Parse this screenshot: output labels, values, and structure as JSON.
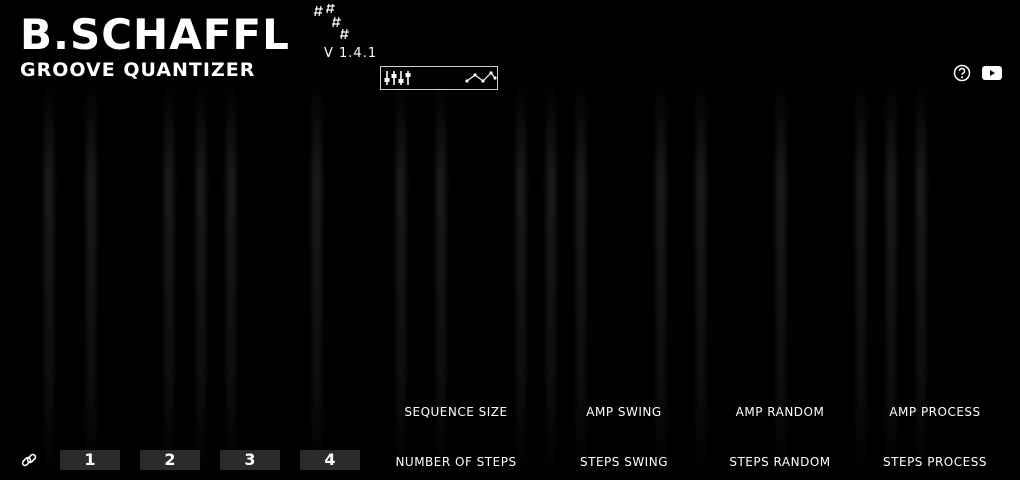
{
  "header": {
    "title": "B.SCHAFFL",
    "subtitle": "GROOVE QUANTIZER",
    "version": "V 1.4.1"
  },
  "mode_tabs": [
    {
      "icon": "sliders-icon"
    },
    {
      "icon": "curve-icon"
    }
  ],
  "top_right_icons": [
    "help-icon",
    "youtube-icon"
  ],
  "knobs": {
    "row1": [
      "SEQUENCE SIZE",
      "AMP SWING",
      "AMP RANDOM",
      "AMP PROCESS"
    ],
    "row2": [
      "NUMBER OF STEPS",
      "STEPS SWING",
      "STEPS RANDOM",
      "STEPS PROCESS"
    ]
  },
  "presets": [
    "1",
    "2",
    "3",
    "4"
  ],
  "link_icon": "link-icon"
}
